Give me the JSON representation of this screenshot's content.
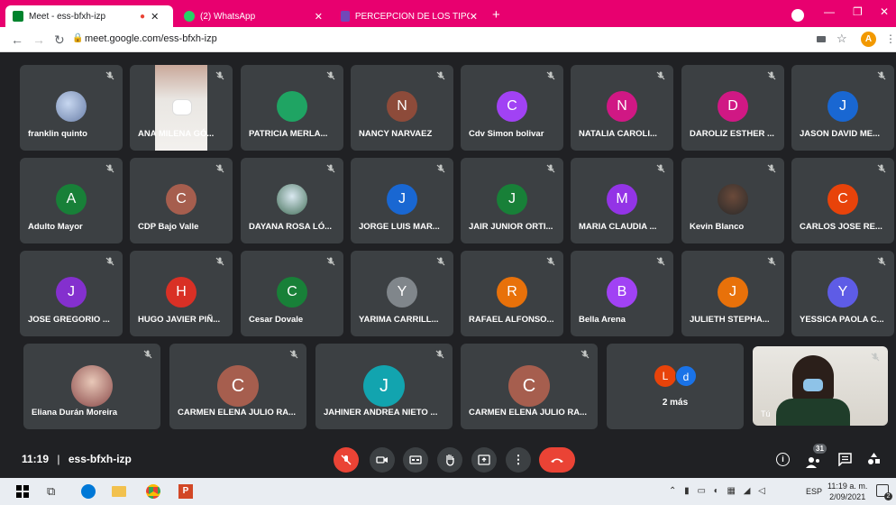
{
  "tabs": [
    {
      "label": "Meet - ess-bfxh-izp"
    },
    {
      "label": "(2) WhatsApp"
    },
    {
      "label": "PERCEPCIÓN DE LOS TIPOS DE"
    }
  ],
  "address_bar": {
    "url": "meet.google.com/ess-bfxh-izp",
    "profile_initial": "A"
  },
  "participants": [
    {
      "name": "franklin quinto"
    },
    {
      "name": "ANA MILENA GÓ..."
    },
    {
      "name": "PATRICIA MERLA..."
    },
    {
      "name": "NANCY NARVAEZ",
      "initial": "N"
    },
    {
      "name": "Cdv Simon bolivar",
      "initial": "C"
    },
    {
      "name": "NATALIA CAROLI...",
      "initial": "N"
    },
    {
      "name": "DAROLIZ ESTHER ...",
      "initial": "D"
    },
    {
      "name": "JASON DAVID ME...",
      "initial": "J"
    },
    {
      "name": "Adulto Mayor",
      "initial": "A"
    },
    {
      "name": "CDP Bajo Valle",
      "initial": "C"
    },
    {
      "name": "DAYANA ROSA LÓ..."
    },
    {
      "name": "JORGE LUIS MAR...",
      "initial": "J"
    },
    {
      "name": "JAIR JUNIOR ORTI...",
      "initial": "J"
    },
    {
      "name": "MARIA CLAUDIA ...",
      "initial": "M"
    },
    {
      "name": "Kevin Blanco"
    },
    {
      "name": "CARLOS JOSE RE...",
      "initial": "C"
    },
    {
      "name": "JOSE GREGORIO ...",
      "initial": "J"
    },
    {
      "name": "HUGO JAVIER PIÑ...",
      "initial": "H"
    },
    {
      "name": "Cesar Dovale",
      "initial": "C"
    },
    {
      "name": "YARIMA CARRILL...",
      "initial": "Y"
    },
    {
      "name": "RAFAEL ALFONSO...",
      "initial": "R"
    },
    {
      "name": "Bella Arena",
      "initial": "B"
    },
    {
      "name": "JULIETH STEPHA...",
      "initial": "J"
    },
    {
      "name": "YESSICA PAOLA C...",
      "initial": "Y"
    },
    {
      "name": "Eliana Durán Moreira"
    },
    {
      "name": "CARMEN ELENA JULIO RA...",
      "initial": "C"
    },
    {
      "name": "JAHINER ANDREA NIETO ...",
      "initial": "J"
    },
    {
      "name": "CARMEN ELENA JULIO RA...",
      "initial": "C"
    }
  ],
  "more": {
    "initials": [
      "L",
      "d"
    ],
    "label": "2 más"
  },
  "self": {
    "label": "Tú"
  },
  "meeting": {
    "time": "11:19",
    "code": "ess-bfxh-izp",
    "participant_count": "31"
  },
  "taskbar": {
    "lang": "ESP",
    "time": "11:19 a. m.",
    "date": "2/09/2021",
    "notif_count": "2"
  },
  "colors": {
    "tabbar": "#e8006f",
    "leave": "#ea4335",
    "tile": "#3c4043"
  }
}
